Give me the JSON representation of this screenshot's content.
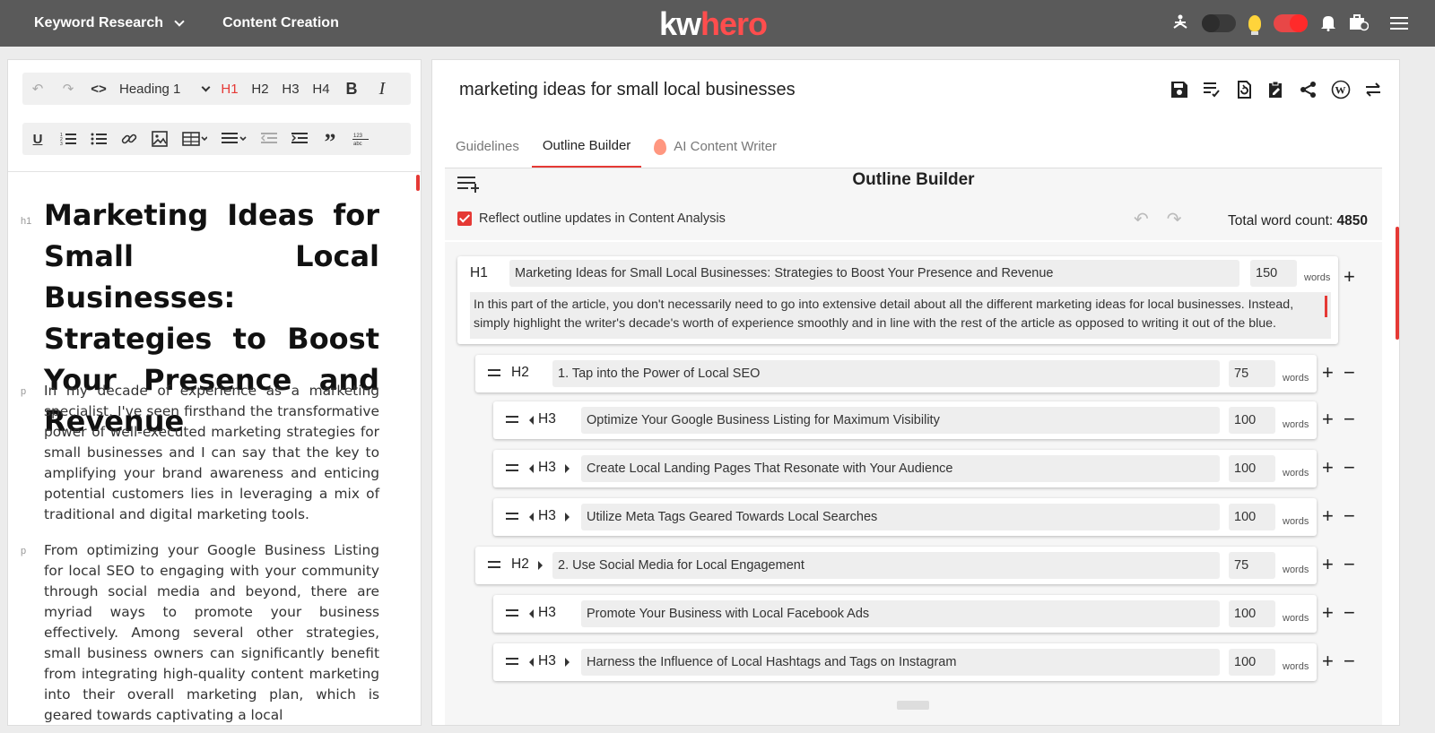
{
  "nav": {
    "keyword_research": "Keyword Research",
    "content_creation": "Content Creation",
    "logo_part1": "kw",
    "logo_part2": "hero"
  },
  "editor": {
    "heading_select": "Heading 1",
    "heading_buttons": [
      "H1",
      "H2",
      "H3",
      "H4"
    ],
    "bold_label": "B",
    "italic_label": "I",
    "h1_tag": "h1",
    "p_tag": "p",
    "h1_text": "Marketing Ideas for Small Local Businesses: Strategies to Boost Your Presence and Revenue",
    "para1": "In my decade of experience as a marketing specialist, I've seen firsthand the transformative power of well-executed marketing strategies for small businesses and I can say that the key to amplifying your brand awareness and enticing potential customers lies in leveraging a mix of traditional and digital marketing tools.",
    "para2": "From optimizing your Google Business Listing for local SEO to engaging with your community through social media and beyond, there are myriad ways to promote your business effectively. Among several other strategies, small business owners can significantly benefit from integrating high-quality content marketing into their overall marketing plan, which is geared towards captivating a local"
  },
  "doc": {
    "title": "marketing ideas for small local businesses"
  },
  "tabs": [
    {
      "label": "Guidelines"
    },
    {
      "label": "Outline Builder"
    },
    {
      "label": "AI Content Writer"
    }
  ],
  "outline": {
    "title": "Outline Builder",
    "reflect_label": "Reflect outline updates in Content Analysis",
    "word_count_label": "Total word count:",
    "word_count_value": "4850",
    "words_label": "words",
    "h1": {
      "level": "H1",
      "text": "Marketing Ideas for Small Local Businesses: Strategies to Boost Your Presence and Revenue",
      "count": "150",
      "description": "In this part of the article, you don't necessarily need to go into extensive detail about all the different marketing ideas for local businesses. Instead, simply highlight the writer's decade's worth of experience smoothly and in line with the rest of the article as opposed to writing it out of the blue."
    },
    "rows": [
      {
        "level": "H2",
        "text": "1. Tap into the Power of Local SEO",
        "count": "75"
      },
      {
        "level": "H3",
        "text": "Optimize Your Google Business Listing for Maximum Visibility",
        "count": "100"
      },
      {
        "level": "H3",
        "text": "Create Local Landing Pages That Resonate with Your Audience",
        "count": "100"
      },
      {
        "level": "H3",
        "text": "Utilize Meta Tags Geared Towards Local Searches",
        "count": "100"
      },
      {
        "level": "H2",
        "text": "2. Use Social Media for Local Engagement",
        "count": "75"
      },
      {
        "level": "H3",
        "text": "Promote Your Business with Local Facebook Ads",
        "count": "100"
      },
      {
        "level": "H3",
        "text": "Harness the Influence of Local Hashtags and Tags on Instagram",
        "count": "100"
      }
    ]
  }
}
